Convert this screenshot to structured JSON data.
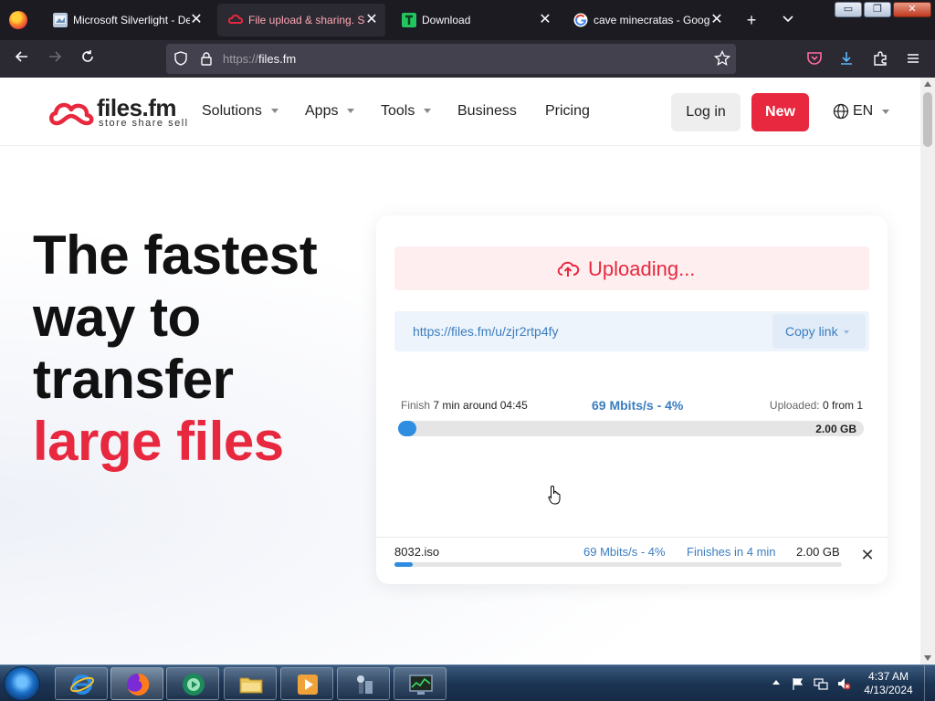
{
  "browser": {
    "tabs": [
      {
        "title": "Microsoft Silverlight - De",
        "icon": "silverlight-favicon",
        "active": false
      },
      {
        "title": "File upload & sharing. Se",
        "icon": "filesfm-favicon",
        "active": true
      },
      {
        "title": "Download",
        "icon": "download-favicon",
        "active": false
      },
      {
        "title": "cave minecratas - Google",
        "icon": "google-favicon",
        "active": false
      }
    ],
    "new_tab_glyph": "+",
    "list_tabs_glyph": "⌄",
    "window_buttons": {
      "minimize": "▭",
      "restore": "❐",
      "close": "✕"
    },
    "url": {
      "scheme": "https://",
      "host": "files.fm"
    }
  },
  "site": {
    "logo": {
      "name": "files.fm",
      "tagline": "store share sell"
    },
    "menu": [
      {
        "label": "Solutions",
        "has_caret": true
      },
      {
        "label": "Apps",
        "has_caret": true
      },
      {
        "label": "Tools",
        "has_caret": true
      },
      {
        "label": "Business",
        "has_caret": false
      },
      {
        "label": "Pricing",
        "has_caret": false
      }
    ],
    "login_label": "Log in",
    "new_label": "New",
    "language": "EN"
  },
  "hero": {
    "line1": "The fastest",
    "line2": "way to",
    "line3": "transfer",
    "line4": "large files"
  },
  "upload": {
    "status": "Uploading...",
    "share_link": "https://files.fm/u/zjr2rtp4fy",
    "copy_label": "Copy link",
    "finish_label": "Finish",
    "finish_value": "7 min around 04:45",
    "speed": "69 Mbits/s - 4%",
    "uploaded_label": "Uploaded:",
    "uploaded_value": "0 from 1",
    "total_size": "2.00 GB",
    "progress_fraction": 0.04,
    "file": {
      "name": "8032.iso",
      "speed": "69 Mbits/s - 4%",
      "eta": "Finishes in 4 min",
      "size": "2.00 GB",
      "progress_fraction": 0.04,
      "close_glyph": "✕"
    }
  },
  "taskbar": {
    "apps": [
      "internet-explorer",
      "firefox",
      "media-center",
      "file-explorer",
      "media-player",
      "control-panel",
      "task-manager"
    ],
    "time": "4:37 AM",
    "date": "4/13/2024"
  },
  "colors": {
    "brand_red": "#e8283e",
    "link_blue": "#3a7dbf",
    "progress_blue": "#2e8de0"
  }
}
